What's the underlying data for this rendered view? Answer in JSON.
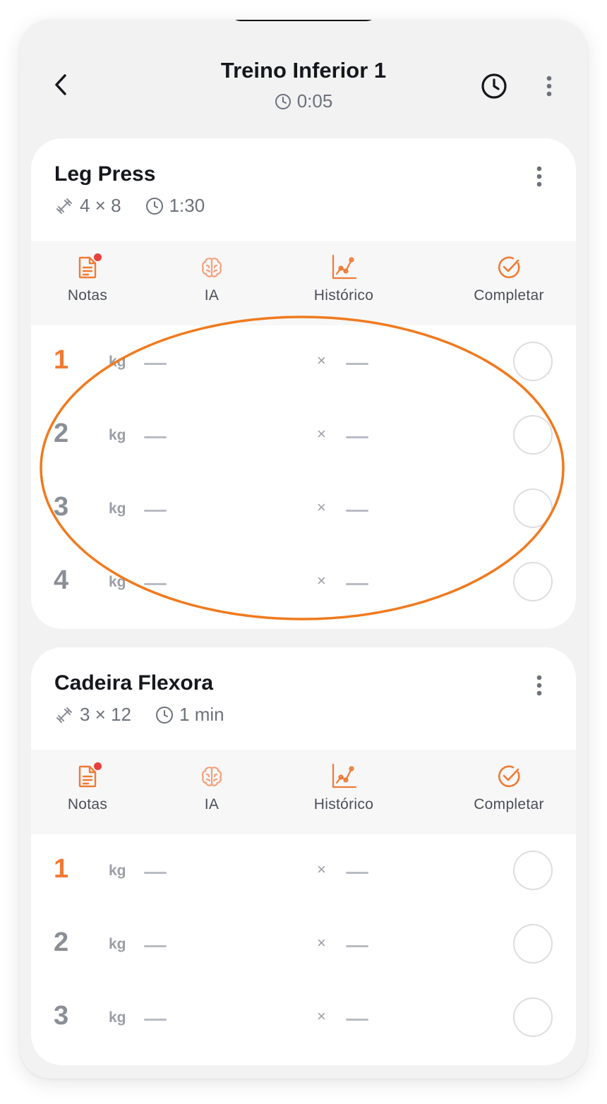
{
  "header": {
    "title": "Treino Inferior 1",
    "elapsed": "0:05"
  },
  "tools": {
    "notes": "Notas",
    "ai": "IA",
    "history": "Histórico",
    "complete": "Completar"
  },
  "set_labels": {
    "unit": "kg",
    "times": "×",
    "placeholder": "—"
  },
  "exercises": [
    {
      "name": "Leg Press",
      "sets_reps": "4 × 8",
      "rest": "1:30",
      "notes_badge": true,
      "sets": [
        "1",
        "2",
        "3",
        "4"
      ]
    },
    {
      "name": "Cadeira Flexora",
      "sets_reps": "3 × 12",
      "rest": "1 min",
      "notes_badge": true,
      "sets": [
        "1",
        "2",
        "3"
      ]
    }
  ],
  "colors": {
    "accent": "#f07a33",
    "badge": "#e8403a",
    "annotation": "#f07a1e"
  },
  "icons": {
    "back": "chevron-left-icon",
    "history": "clock-icon",
    "more": "vertical-dots-icon",
    "sets": "dumbbell-icon",
    "rest": "clock-icon",
    "notes": "document-icon",
    "ai": "brain-icon",
    "chart": "chart-icon",
    "complete": "check-circle-icon"
  }
}
